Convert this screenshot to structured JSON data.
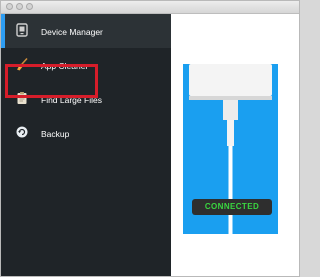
{
  "window": {
    "traffic_lights": [
      "close",
      "minimize",
      "zoom"
    ]
  },
  "sidebar": {
    "items": [
      {
        "label": "Device Manager",
        "icon": "device-manager-icon",
        "active": true
      },
      {
        "label": "App Cleaner",
        "icon": "broom-icon",
        "highlighted": true
      },
      {
        "label": "Find Large Files",
        "icon": "clipboard-icon"
      },
      {
        "label": "Backup",
        "icon": "backup-icon"
      }
    ]
  },
  "device": {
    "status": "CONNECTED",
    "status_color": "#39d640",
    "screen_color": "#1a9ff0"
  },
  "colors": {
    "sidebar_bg": "#1f2428",
    "accent": "#2e9df2",
    "highlight_box": "#d61d2a"
  }
}
